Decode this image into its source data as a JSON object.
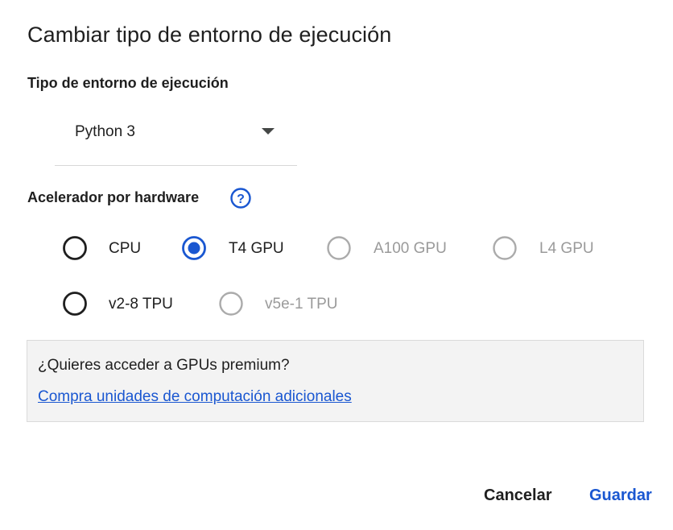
{
  "dialog": {
    "title": "Cambiar tipo de entorno de ejecución"
  },
  "runtime": {
    "label": "Tipo de entorno de ejecución",
    "selected_value": "Python 3"
  },
  "accelerator": {
    "label": "Acelerador por hardware",
    "help_icon": "help-circle-icon",
    "options": [
      {
        "label": "CPU",
        "selected": false,
        "disabled": false
      },
      {
        "label": "T4 GPU",
        "selected": true,
        "disabled": false
      },
      {
        "label": "A100 GPU",
        "selected": false,
        "disabled": true
      },
      {
        "label": "L4 GPU",
        "selected": false,
        "disabled": true
      },
      {
        "label": "v2-8 TPU",
        "selected": false,
        "disabled": false
      },
      {
        "label": "v5e-1 TPU",
        "selected": false,
        "disabled": true
      }
    ]
  },
  "premium": {
    "question": "¿Quieres acceder a GPUs premium?",
    "link_text": "Compra unidades de computación adicionales"
  },
  "buttons": {
    "cancel": "Cancelar",
    "save": "Guardar"
  },
  "colors": {
    "accent": "#1a57d1",
    "text": "#1f1f1f",
    "disabled": "#9a9a9a",
    "box_bg": "#f3f3f3"
  }
}
